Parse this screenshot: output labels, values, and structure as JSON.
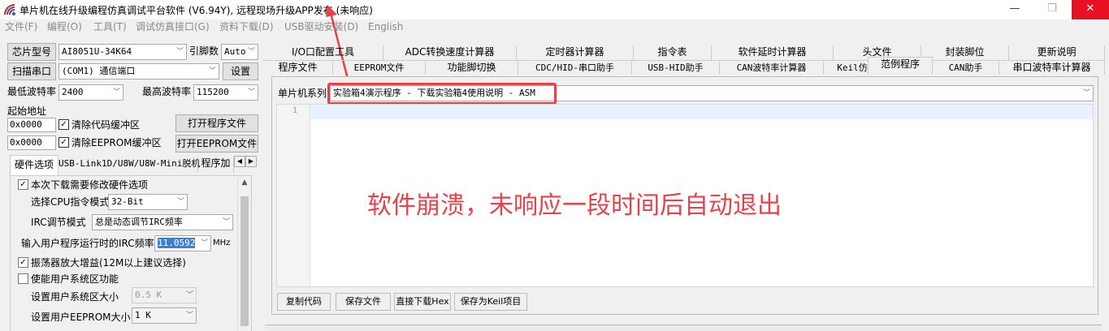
{
  "window": {
    "title": "单片机在线升级编程仿真调试平台软件 (V6.94Y), 远程现场升级APP发布 (未响应)",
    "min_glyph": "—",
    "max_glyph": "❐",
    "close_glyph": "✕"
  },
  "menu": [
    "文件(F)",
    "编程(O)",
    "工具(T)",
    "调试仿真接口(G)",
    "资料下载(D)",
    "USB驱动安装(D)",
    "English"
  ],
  "left": {
    "chip_model_label": "芯片型号",
    "chip_model_value": "AI8051U-34K64",
    "pins_label": "引脚数",
    "pins_value": "Auto",
    "scan_port_button": "扫描串口",
    "port_value": "(COM1) 通信端口",
    "settings_button": "设置",
    "min_baud_label": "最低波特率",
    "min_baud_value": "2400",
    "max_baud_label": "最高波特率",
    "max_baud_value": "115200",
    "start_addr_label": "起始地址",
    "addr1_value": "0x0000",
    "clear_code_label": "清除代码缓冲区",
    "open_program_button": "打开程序文件",
    "addr2_value": "0x0000",
    "clear_eeprom_label": "清除EEPROM缓冲区",
    "open_eeprom_button": "打开EEPROM文件",
    "lower_tabs": [
      "硬件选项",
      "USB-Link1D/U8W/U8W-Mini脱机",
      "程序加"
    ],
    "hw": {
      "modify_hw_label": "本次下载需要修改硬件选项",
      "cpu_mode_label": "选择CPU指令模式",
      "cpu_mode_value": "32-Bit",
      "irc_mode_label": "IRC调节模式",
      "irc_mode_value": "总是动态调节IRC频率",
      "irc_freq_label": "输入用户程序运行时的IRC频率",
      "irc_freq_value": "11.0592",
      "irc_freq_unit": "MHz",
      "osc_gain_label": "振荡器放大增益(12M以上建议选择)",
      "user_sys_label": "使能用户系统区功能",
      "sys_size_label": "设置用户系统区大小",
      "sys_size_value": "0.5 K",
      "eeprom_size_label": "设置用户EEPROM大小",
      "eeprom_size_value": "1   K"
    }
  },
  "right": {
    "tabs_row1": [
      "I/O口配置工具",
      "ADC转换速度计算器",
      "定时器计算器",
      "指令表",
      "软件延时计算器",
      "头文件",
      "封装脚位",
      "更新说明"
    ],
    "tabs_row2": [
      "程序文件",
      "EEPROM文件",
      "功能脚切换",
      "CDC/HID-串口助手",
      "USB-HID助手",
      "CAN波特率计算器",
      "Keil仿真设置",
      "范例程序",
      "CAN助手",
      "串口波特率计算器"
    ],
    "series_label": "单片机系列",
    "series_value": "实验箱4演示程序 - 下载实验箱4使用说明 - ASM",
    "line_number": "1",
    "annotation": "软件崩溃，未响应一段时间后自动退出",
    "buttons": [
      "复制代码",
      "保存文件",
      "直接下载Hex",
      "保存为Keil项目"
    ]
  },
  "colors": {
    "annotation": "#e8414a",
    "close_button": "#e81123",
    "highlight": "#e8414a"
  }
}
